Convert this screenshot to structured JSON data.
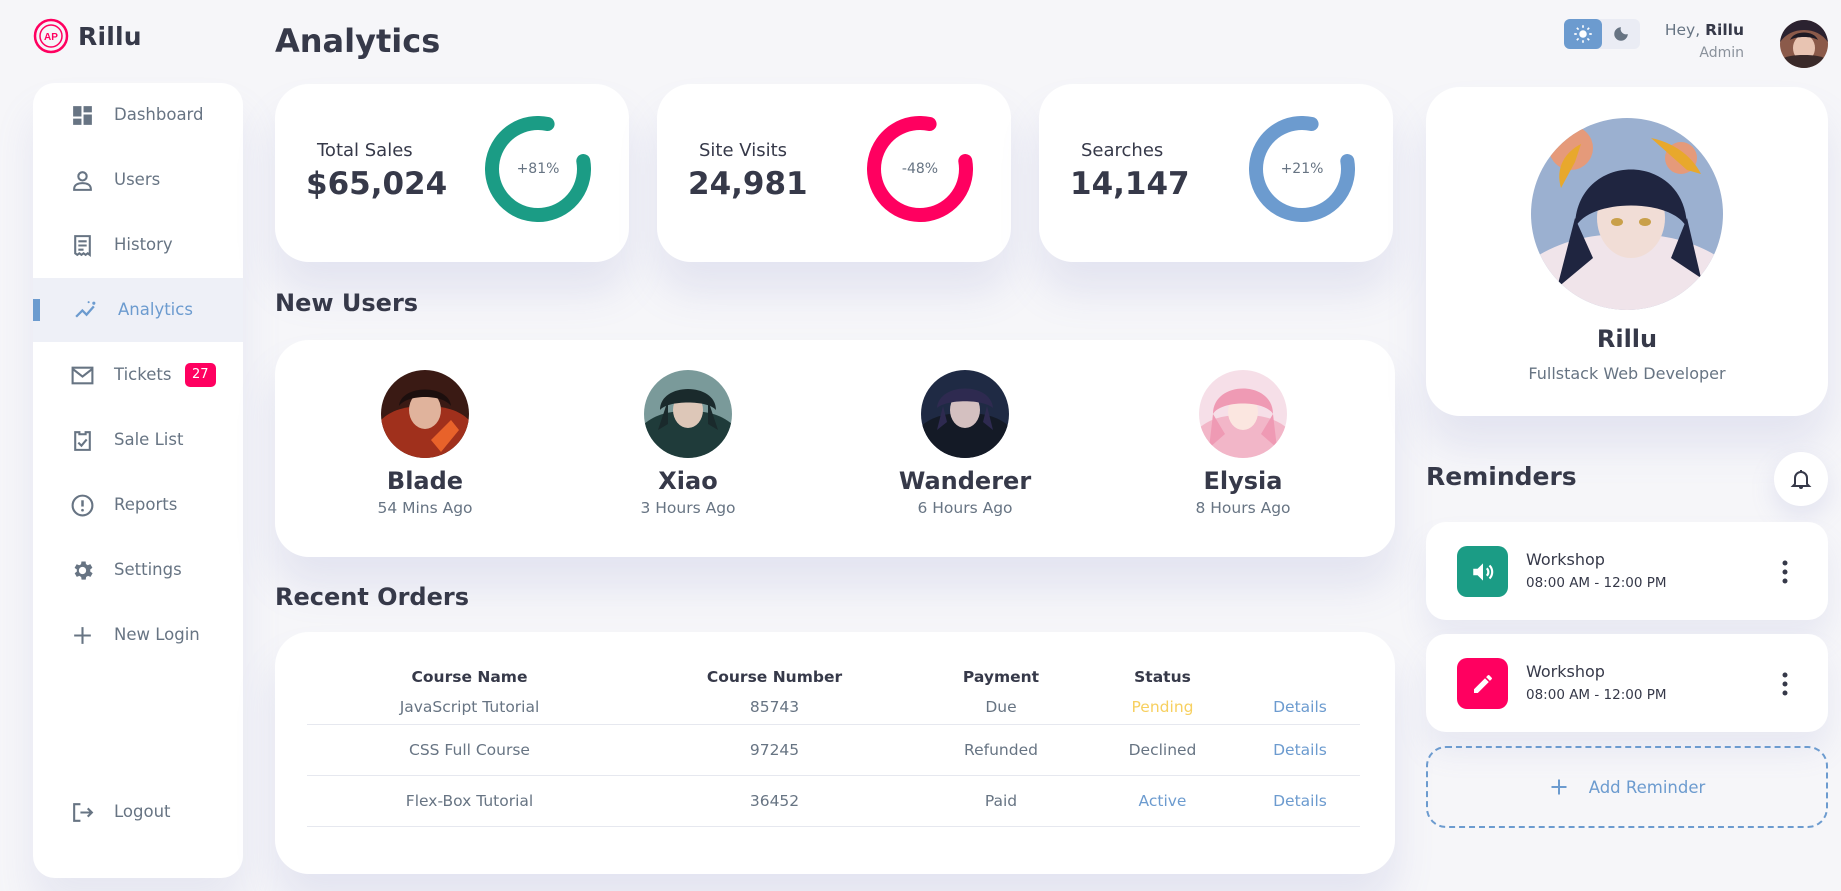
{
  "brand": {
    "name": "Rillu",
    "logo_text": "AP"
  },
  "sidebar": {
    "items": [
      {
        "label": "Dashboard",
        "icon": "dashboard-icon"
      },
      {
        "label": "Users",
        "icon": "person-icon"
      },
      {
        "label": "History",
        "icon": "receipt-icon"
      },
      {
        "label": "Analytics",
        "icon": "insights-icon",
        "active": true
      },
      {
        "label": "Tickets",
        "icon": "mail-icon",
        "badge": "27"
      },
      {
        "label": "Sale List",
        "icon": "inventory-icon"
      },
      {
        "label": "Reports",
        "icon": "report-icon"
      },
      {
        "label": "Settings",
        "icon": "gear-icon"
      },
      {
        "label": "New Login",
        "icon": "plus-icon"
      }
    ],
    "logout": {
      "label": "Logout",
      "icon": "logout-icon"
    }
  },
  "header": {
    "title": "Analytics",
    "greeting": "Hey, ",
    "user_name": "Rillu",
    "role": "Admin",
    "theme": {
      "light_icon": "sun-icon",
      "dark_icon": "moon-icon",
      "selected": "light"
    }
  },
  "stats": [
    {
      "label": "Total Sales",
      "value": "$65,024",
      "percent": "+81%",
      "fraction": 0.81,
      "color": "#1b9c85"
    },
    {
      "label": "Site Visits",
      "value": "24,981",
      "percent": "-48%",
      "fraction": 0.81,
      "color": "#ff0060"
    },
    {
      "label": "Searches",
      "value": "14,147",
      "percent": "+21%",
      "fraction": 0.81,
      "color": "#6c9bcf"
    }
  ],
  "new_users": {
    "title": "New Users",
    "users": [
      {
        "name": "Blade",
        "time": "54 Mins Ago"
      },
      {
        "name": "Xiao",
        "time": "3 Hours Ago"
      },
      {
        "name": "Wanderer",
        "time": "6 Hours Ago"
      },
      {
        "name": "Elysia",
        "time": "8 Hours Ago"
      }
    ]
  },
  "orders": {
    "title": "Recent Orders",
    "columns": [
      "Course Name",
      "Course Number",
      "Payment",
      "Status",
      ""
    ],
    "rows": [
      {
        "course": "JavaScript Tutorial",
        "number": "85743",
        "payment": "Due",
        "status": "Pending",
        "action": "Details"
      },
      {
        "course": "CSS Full Course",
        "number": "97245",
        "payment": "Refunded",
        "status": "Declined",
        "action": "Details"
      },
      {
        "course": "Flex-Box Tutorial",
        "number": "36452",
        "payment": "Paid",
        "status": "Active",
        "action": "Details"
      }
    ]
  },
  "profile": {
    "name": "Rillu",
    "title": "Fullstack Web Developer"
  },
  "reminders": {
    "title": "Reminders",
    "items": [
      {
        "title": "Workshop",
        "time": "08:00 AM - 12:00 PM",
        "icon": "volume-icon",
        "color": "#1b9c85"
      },
      {
        "title": "Workshop",
        "time": "08:00 AM - 12:00 PM",
        "icon": "edit-icon",
        "color": "#ff0060"
      }
    ],
    "add_label": "Add Reminder"
  }
}
